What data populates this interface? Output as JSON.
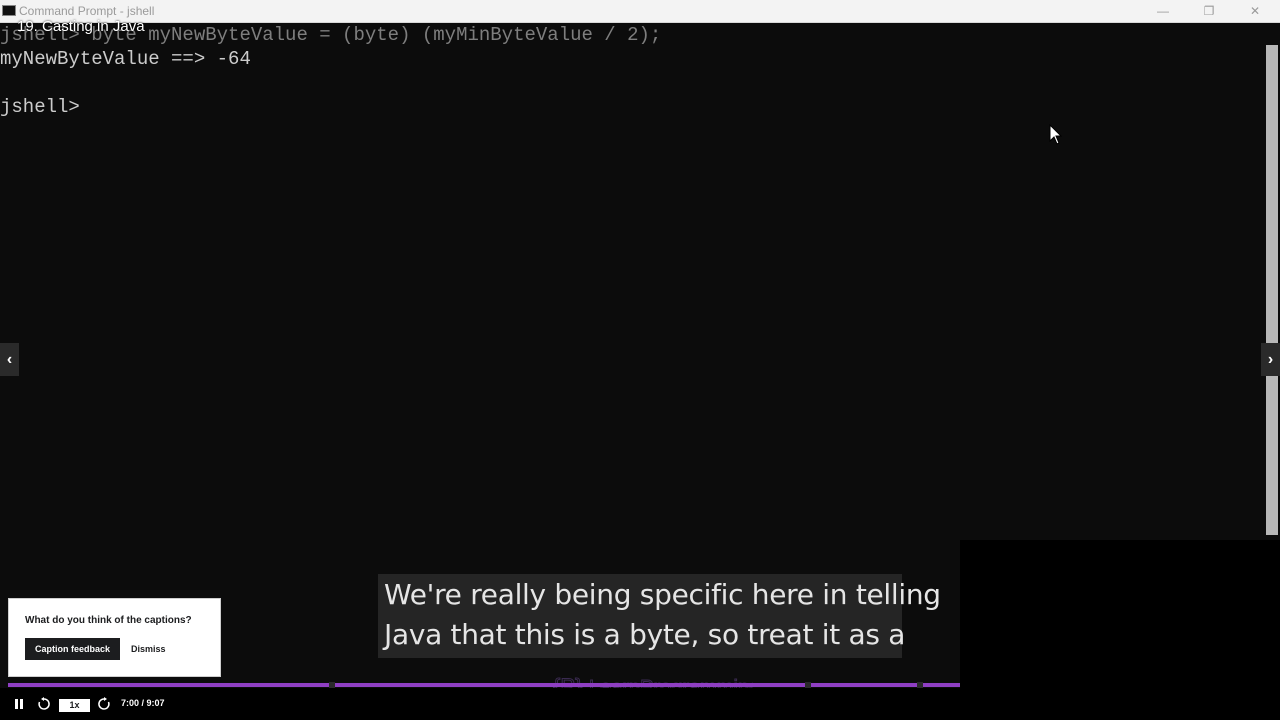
{
  "window": {
    "title": "Command Prompt - jshell"
  },
  "video": {
    "title": "19. Casting in Java"
  },
  "terminal": {
    "lines": [
      "jshell> byte myNewByteValue = (byte) (myMinByteValue / 2);",
      "myNewByteValue ==> -64",
      "",
      "jshell>"
    ]
  },
  "caption": {
    "line1": "We're really being specific here in telling",
    "line2": "Java that this is a byte, so treat it as a"
  },
  "feedback": {
    "question": "What do you think of the captions?",
    "feedback_button": "Caption feedback",
    "dismiss_button": "Dismiss"
  },
  "player": {
    "speed": "1x",
    "time": "7:00 / 9:07",
    "progress_fraction": 1.0
  },
  "logo": {
    "name": "LearnProgramming",
    "sub": "academy"
  },
  "colors": {
    "progress": "#8f3fc3",
    "terminal_bg": "#0c0c0c",
    "terminal_text": "#cccccc"
  }
}
